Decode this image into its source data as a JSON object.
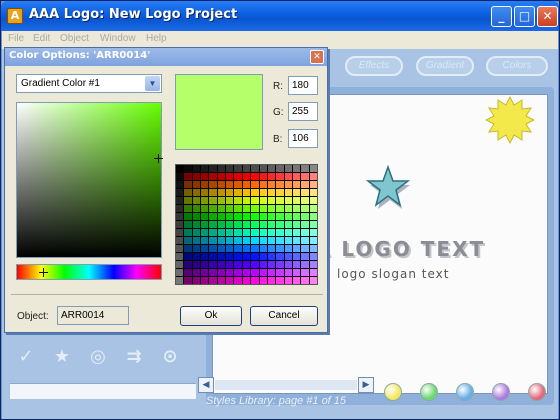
{
  "window": {
    "title": "AAA Logo: New Logo Project",
    "icon_glyph": "A",
    "minimize_glyph": "_",
    "maximize_glyph": "□",
    "close_glyph": "✕"
  },
  "menu": [
    "File",
    "Edit",
    "Object",
    "Window",
    "Help"
  ],
  "toolbar_pills": [
    "Effects",
    "Gradient",
    "Colors"
  ],
  "logo": {
    "text": "R LOGO TEXT",
    "slogan": "logo slogan text",
    "star_color": "#7fc6cf",
    "sun_color": "#f3e94a"
  },
  "styles_library": {
    "label": "Styles Library: page #1 of 15",
    "scroll_left": "◀",
    "scroll_right": "▶",
    "ball_colors": [
      "#f2e860",
      "#6fd66f",
      "#6aaee6",
      "#b07ae0",
      "#e26a7a"
    ]
  },
  "left_tools": [
    "✓",
    "★",
    "◎",
    "⇉",
    "⊙"
  ],
  "dialog": {
    "title": "Color Options: 'ARR0014'",
    "close_glyph": "✕",
    "gradient_select": "Gradient Color #1",
    "select_arrow": "▼",
    "preview_color": "#b4ff6a",
    "rgb_labels": {
      "r": "R:",
      "g": "G:",
      "b": "B:"
    },
    "rgb_values": {
      "r": "180",
      "g": "255",
      "b": "106"
    },
    "object_label": "Object:",
    "object_value": "ARR0014",
    "ok_label": "Ok",
    "cancel_label": "Cancel"
  }
}
